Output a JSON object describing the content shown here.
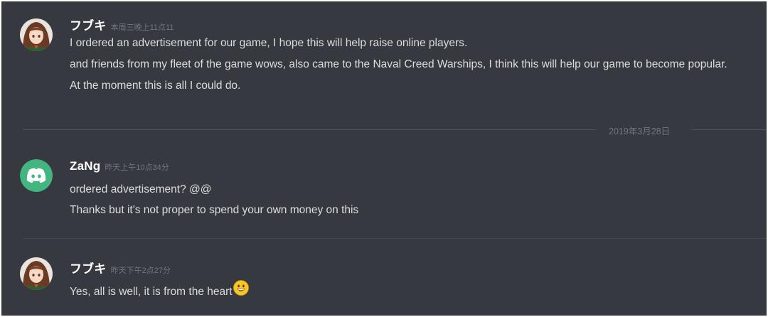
{
  "messages": [
    {
      "username": "フブキ",
      "timestamp": "本周三晚上11点11",
      "avatar_icon": "anime-girl-avatar-icon",
      "lines": [
        "I ordered an advertisement for our game, I hope this will help raise online players.",
        "and friends from my fleet of the game wows, also came to the Naval Creed Warships, I think this will help our game to become popular.",
        "At the moment this is all I could do."
      ]
    },
    {
      "username": "ZaNg",
      "timestamp": "昨天上午10点34分",
      "avatar_icon": "discord-logo-avatar-icon",
      "lines": [
        "ordered advertisement? @@",
        "Thanks but it's not proper to spend your own money on this"
      ]
    },
    {
      "username": "フブキ",
      "timestamp": "昨天下午2点27分",
      "avatar_icon": "anime-girl-avatar-icon",
      "lines": [
        "Yes, all is well, it is from the heart"
      ],
      "emoji": "grinning-face-emoji"
    }
  ],
  "date_divider": "2019年3月28日",
  "colors": {
    "background": "#36393f",
    "username": "#ffffff",
    "message_text": "#dcddde",
    "timestamp": "#72767d",
    "discord_avatar_bg": "#43b581"
  }
}
